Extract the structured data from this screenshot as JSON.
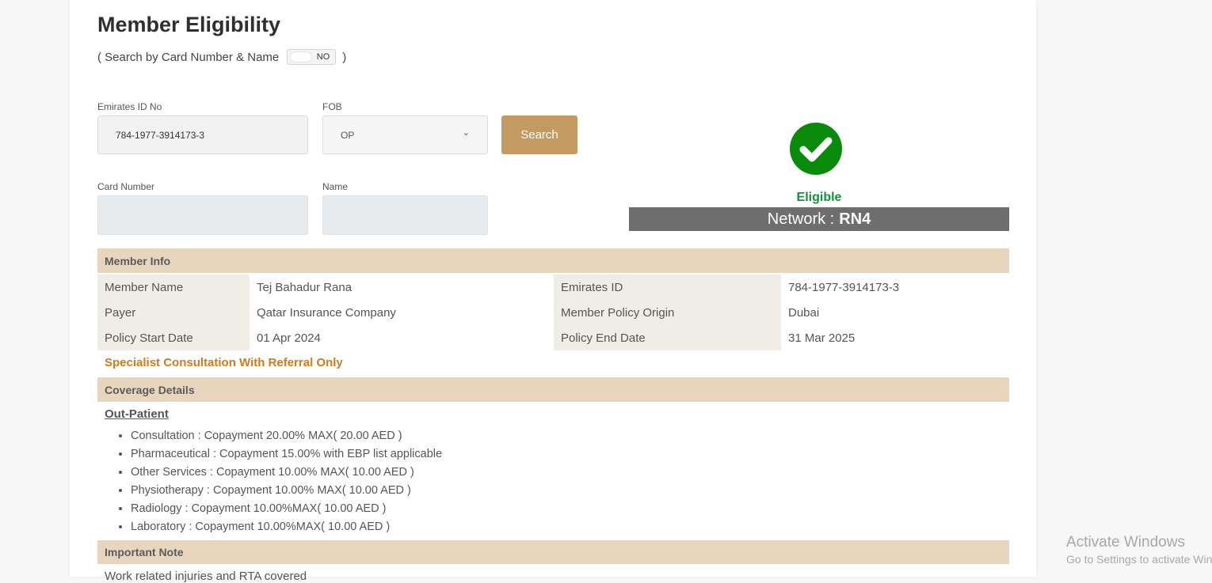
{
  "page": {
    "title": "Member Eligibility",
    "toggle_prefix": "( Search by Card Number & Name",
    "toggle_value": "NO",
    "toggle_suffix": ")"
  },
  "form": {
    "emirates_id_label": "Emirates ID No",
    "emirates_id_value": "784-1977-3914173-3",
    "fob_label": "FOB",
    "fob_value": "OP",
    "search_label": "Search",
    "card_number_label": "Card Number",
    "card_number_value": "",
    "name_label": "Name",
    "name_value": ""
  },
  "status": {
    "eligible_text": "Eligible",
    "network_prefix": "Network :",
    "network_value": "RN4",
    "icon": "check-circle-icon",
    "color": "#0a8a0a"
  },
  "member_info": {
    "header": "Member Info",
    "rows": [
      {
        "label1": "Member Name",
        "value1": "Tej Bahadur Rana",
        "label2": "Emirates ID",
        "value2": "784-1977-3914173-3"
      },
      {
        "label1": "Payer",
        "value1": "Qatar Insurance Company",
        "label2": "Member Policy Origin",
        "value2": "Dubai"
      },
      {
        "label1": "Policy Start Date",
        "value1": "01 Apr 2024",
        "label2": "Policy End Date",
        "value2": "31 Mar 2025"
      }
    ],
    "specialist_note": "Specialist Consultation With Referral Only"
  },
  "coverage": {
    "header": "Coverage Details",
    "subheader": "Out-Patient",
    "items": [
      "Consultation : Copayment 20.00% MAX( 20.00 AED )",
      "Pharmaceutical : Copayment 15.00% with EBP list applicable",
      "Other Services : Copayment 10.00% MAX( 10.00 AED )",
      "Physiotherapy : Copayment 10.00% MAX( 10.00 AED )",
      "Radiology : Copayment 10.00%MAX( 10.00 AED )",
      "Laboratory : Copayment 10.00%MAX( 10.00 AED )"
    ]
  },
  "important_note": {
    "header": "Important Note",
    "text": "Work related injuries and RTA covered"
  },
  "watermark": {
    "line1": "Activate Windows",
    "line2": "Go to Settings to activate Windows."
  },
  "colors": {
    "accent": "#c49a63",
    "section_header": "#e8d5bd",
    "network_bar": "#6e6e6e",
    "specialist": "#d07a1f"
  }
}
